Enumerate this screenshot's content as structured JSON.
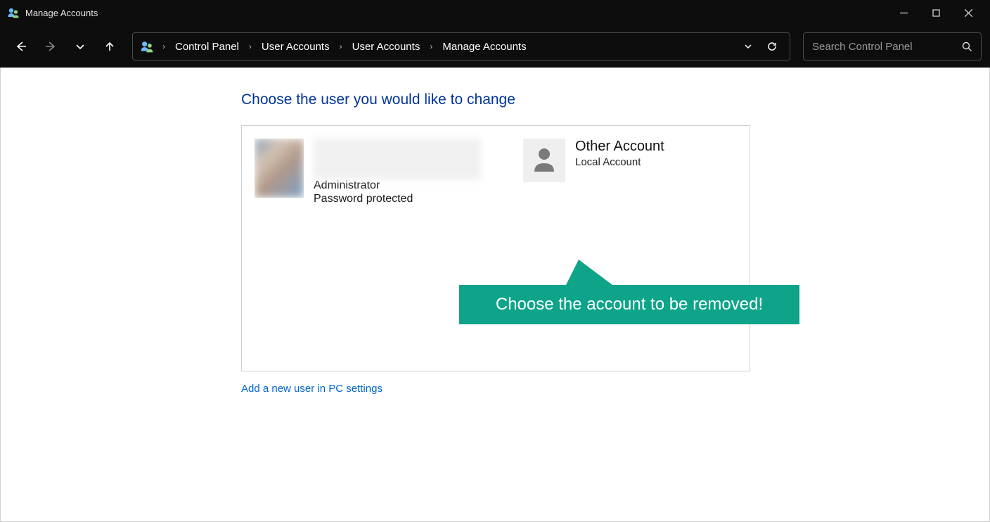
{
  "window": {
    "title": "Manage Accounts"
  },
  "breadcrumb": {
    "items": [
      "Control Panel",
      "User Accounts",
      "User Accounts",
      "Manage Accounts"
    ]
  },
  "search": {
    "placeholder": "Search Control Panel"
  },
  "page": {
    "heading": "Choose the user you would like to change",
    "add_link": "Add a new user in PC settings"
  },
  "accounts": {
    "primary": {
      "role": "Administrator",
      "protection": "Password protected"
    },
    "other": {
      "name": "Other Account",
      "type": "Local Account"
    }
  },
  "callout": {
    "text": "Choose the account to be removed!"
  }
}
